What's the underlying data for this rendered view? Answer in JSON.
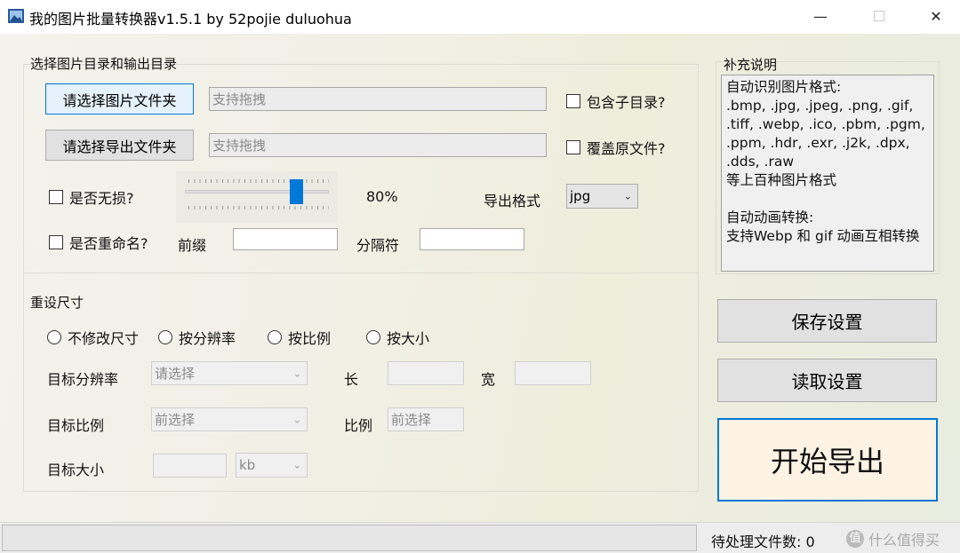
{
  "window": {
    "title": "我的图片批量转换器v1.5.1 by 52pojie duluohua",
    "minimize": "—",
    "close": "✕"
  },
  "dirs": {
    "group_title": "选择图片目录和输出目录",
    "choose_image_folder": "请选择图片文件夹",
    "image_folder_placeholder": "支持拖拽",
    "include_subdirs": "包含子目录?",
    "choose_export_folder": "请选择导出文件夹",
    "export_folder_placeholder": "支持拖拽",
    "overwrite": "覆盖原文件?",
    "lossless": "是否无损?",
    "quality": 80,
    "quality_label": "80%",
    "export_format_label": "导出格式",
    "export_format_value": "jpg",
    "rename": "是否重命名?",
    "prefix_label": "前缀",
    "prefix_value": "",
    "separator_label": "分隔符",
    "separator_value": ""
  },
  "resize": {
    "group_title": "重设尺寸",
    "options": [
      "不修改尺寸",
      "按分辨率",
      "按比例",
      "按大小"
    ],
    "target_resolution_label": "目标分辨率",
    "target_resolution_placeholder": "请选择",
    "length_label": "长",
    "width_label": "宽",
    "target_ratio_label": "目标比例",
    "target_ratio_placeholder": "前选择",
    "ratio_label": "比例",
    "ratio_placeholder": "前选择",
    "target_size_label": "目标大小",
    "size_unit": "kb"
  },
  "notes": {
    "group_title": "补充说明",
    "text": "自动识别图片格式:\n.bmp, .jpg, .jpeg, .png, .gif,\n.tiff, .webp, .ico, .pbm, .pgm,\n.ppm, .hdr, .exr, .j2k, .dpx,\n.dds, .raw\n等上百种图片格式\n\n自动动画转换:\n支持Webp 和 gif 动画互相转换"
  },
  "actions": {
    "save": "保存设置",
    "load": "读取设置",
    "export": "开始导出"
  },
  "status": {
    "pending": "待处理文件数: 0",
    "watermark": "什么值得买",
    "watermark_icon": "值"
  }
}
